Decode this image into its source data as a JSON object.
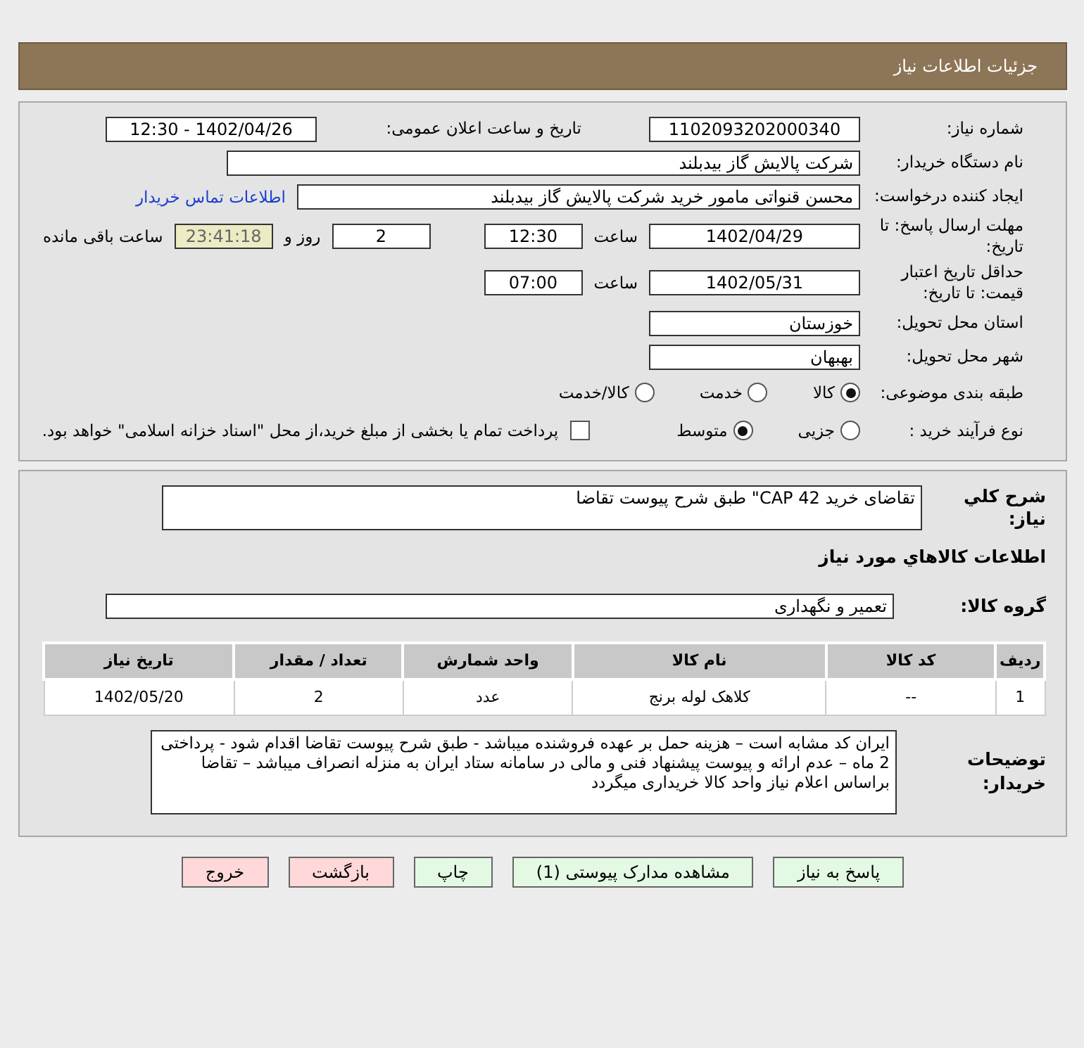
{
  "header": {
    "title": "جزئیات اطلاعات نیاز"
  },
  "details": {
    "need_number": {
      "label": "شماره نیاز:",
      "value": "1102093202000340"
    },
    "announce": {
      "label": "تاریخ و ساعت اعلان عمومی:",
      "value": "1402/04/26 - 12:30"
    },
    "buyer_org": {
      "label": "نام دستگاه خریدار:",
      "value": "شرکت پالایش گاز بیدبلند"
    },
    "requester": {
      "label": "ایجاد کننده درخواست:",
      "value": "محسن قنواتی مامور خرید شرکت پالایش گاز بیدبلند",
      "link": "اطلاعات تماس خریدار"
    },
    "reply_deadline": {
      "label": "مهلت ارسال پاسخ: تا تاریخ:",
      "date": "1402/04/29",
      "time_label": "ساعت",
      "time": "12:30",
      "days": "2",
      "days_label": "روز و",
      "remaining": "23:41:18",
      "remaining_label": "ساعت باقی مانده"
    },
    "validity": {
      "label": "حداقل تاریخ اعتبار قیمت: تا تاریخ:",
      "date": "1402/05/31",
      "time_label": "ساعت",
      "time": "07:00"
    },
    "province": {
      "label": "استان محل تحویل:",
      "value": "خوزستان"
    },
    "city": {
      "label": "شهر محل تحویل:",
      "value": "بهبهان"
    },
    "category": {
      "label": "طبقه بندی موضوعی:",
      "options": [
        {
          "label": "کالا",
          "selected": true
        },
        {
          "label": "خدمت",
          "selected": false
        },
        {
          "label": "کالا/خدمت",
          "selected": false
        }
      ]
    },
    "process": {
      "label": "نوع فرآیند خرید :",
      "options": [
        {
          "label": "جزیی",
          "selected": false
        },
        {
          "label": "متوسط",
          "selected": true
        }
      ],
      "payment": {
        "label": "پرداخت تمام یا بخشی از مبلغ خرید،از محل \"اسناد خزانه اسلامی\" خواهد بود.",
        "checked": false
      }
    }
  },
  "description": {
    "label": "شرح كلي نياز:",
    "value": "تقاضای خرید CAP 42\"  طبق شرح پیوست تقاضا"
  },
  "items_title": "اطلاعات كالاهاي مورد نياز",
  "goods_group": {
    "label": "گروه كالا:",
    "value": "تعمیر و نگهداری"
  },
  "table": {
    "columns": [
      "ردیف",
      "کد کالا",
      "نام کالا",
      "واحد شمارش",
      "تعداد / مقدار",
      "تاریخ نیاز"
    ],
    "rows": [
      [
        "1",
        "--",
        "کلاهک لوله برنج",
        "عدد",
        "2",
        "1402/05/20"
      ]
    ]
  },
  "buyer_notes": {
    "label": "توضیحات خریدار:",
    "value": "ایران کد مشابه است  – هزینه حمل بر عهده فروشنده میباشد -  طبق شرح پیوست تقاضا اقدام شود - پرداختی 2 ماه – عدم ارائه و پیوست  پیشنهاد فنی و مالی در سامانه ستاد ایران به منزله انصراف میباشد  – تقاضا براساس اعلام نیاز واحد کالا خریداری میگردد"
  },
  "buttons": [
    {
      "label": "پاسخ به نیاز",
      "kind": "normal"
    },
    {
      "label": "مشاهده مدارک پیوستی (1)",
      "kind": "normal"
    },
    {
      "label": "چاپ",
      "kind": "normal"
    },
    {
      "label": "بازگشت",
      "kind": "danger"
    },
    {
      "label": "خروج",
      "kind": "danger"
    }
  ]
}
